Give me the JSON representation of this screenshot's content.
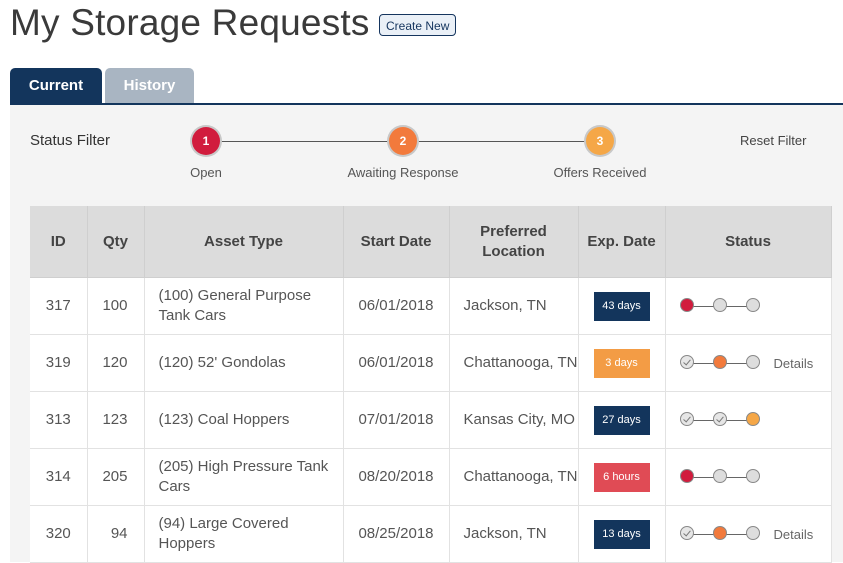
{
  "page": {
    "title": "My Storage Requests",
    "create_label": "Create New"
  },
  "tabs": [
    {
      "label": "Current",
      "active": true
    },
    {
      "label": "History",
      "active": false
    }
  ],
  "filter": {
    "label": "Status Filter",
    "reset_label": "Reset Filter",
    "steps": [
      {
        "number": "1",
        "label": "Open",
        "color": "#d11c3d"
      },
      {
        "number": "2",
        "label": "Awaiting Response",
        "color": "#f27a3c"
      },
      {
        "number": "3",
        "label": "Offers Received",
        "color": "#f5a747"
      }
    ]
  },
  "table": {
    "headers": [
      "ID",
      "Qty",
      "Asset Type",
      "Start Date",
      "Preferred Location",
      "Exp. Date",
      "Status"
    ],
    "rows": [
      {
        "id": "317",
        "qty": "100",
        "asset": "(100) General Purpose Tank Cars",
        "start": "06/01/2018",
        "location": "Jackson, TN",
        "exp": "43 days",
        "exp_color": "#13355c",
        "status": [
          "open",
          "empty",
          "empty"
        ],
        "details": ""
      },
      {
        "id": "319",
        "qty": "120",
        "asset": "(120) 52' Gondolas",
        "start": "06/01/2018",
        "location": "Chattanooga, TN",
        "exp": "3 days",
        "exp_color": "#f39c45",
        "status": [
          "check",
          "awaiting",
          "empty"
        ],
        "details": "Details"
      },
      {
        "id": "313",
        "qty": "123",
        "asset": "(123) Coal Hoppers",
        "start": "07/01/2018",
        "location": "Kansas City, MO",
        "exp": "27 days",
        "exp_color": "#13355c",
        "status": [
          "check",
          "check",
          "offers"
        ],
        "details": ""
      },
      {
        "id": "314",
        "qty": "205",
        "asset": "(205) High Pressure Tank Cars",
        "start": "08/20/2018",
        "location": "Chattanooga, TN",
        "exp": "6 hours",
        "exp_color": "#e04b55",
        "status": [
          "open",
          "empty",
          "empty"
        ],
        "details": ""
      },
      {
        "id": "320",
        "qty": "94",
        "asset": "(94) Large Covered Hoppers",
        "start": "08/25/2018",
        "location": "Jackson, TN",
        "exp": "13 days",
        "exp_color": "#13355c",
        "status": [
          "check",
          "awaiting",
          "empty"
        ],
        "details": "Details"
      }
    ]
  },
  "status_colors": {
    "open": "#d11c3d",
    "awaiting": "#f27a3c",
    "offers": "#f5a747",
    "empty": "#dddddd"
  }
}
